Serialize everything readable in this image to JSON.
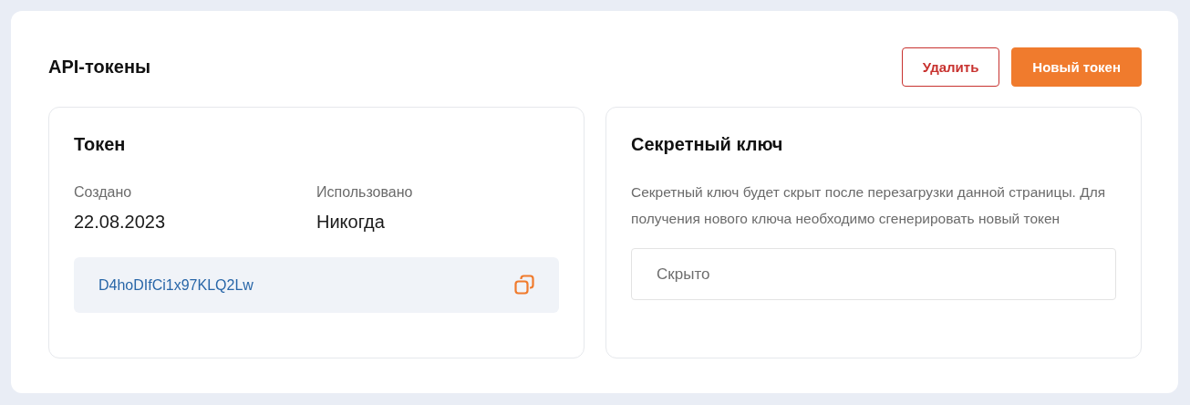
{
  "header": {
    "title": "API-токены",
    "buttons": [
      {
        "label": "Удалить",
        "kind": "danger"
      },
      {
        "label": "Новый токен",
        "kind": "primary"
      }
    ]
  },
  "token_card": {
    "title": "Токен",
    "fields": [
      {
        "label": "Создано",
        "value": "22.08.2023"
      },
      {
        "label": "Использовано",
        "value": "Никогда"
      }
    ],
    "token": "D4hoDIfCi1x97KLQ2Lw"
  },
  "secret_card": {
    "title": "Секретный ключ",
    "description": "Секретный ключ будет скрыт после перезагрузки данной страницы. Для получения нового ключа необходимо сгенерировать новый токен",
    "field": {
      "placeholder": "Скрыто"
    }
  }
}
